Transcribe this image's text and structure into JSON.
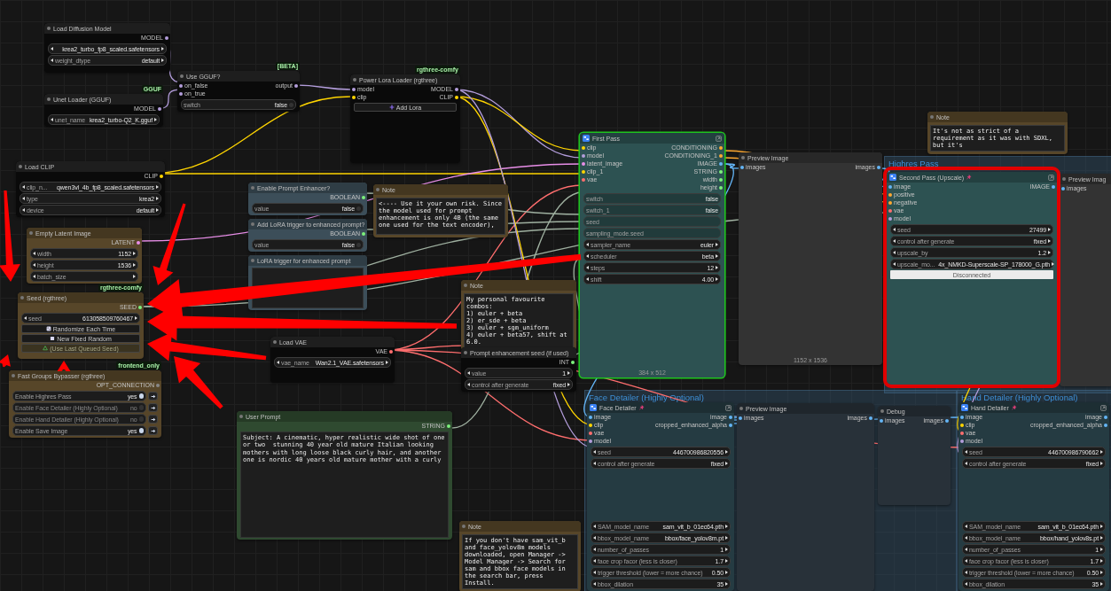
{
  "canvas": {
    "groups": [
      {
        "title": "Highres Pass"
      },
      {
        "title": "Face Detailer (Highly Optional)"
      },
      {
        "title": "Hand Detailer (Highly Optional)"
      }
    ],
    "nodes": [
      {
        "kind": "node",
        "title": "Load Diffusion Model",
        "color": "#0a0a0a",
        "selected": false,
        "outputs": [
          {
            "label": "MODEL",
            "color": "#b39ddb"
          }
        ],
        "widgets": [
          {
            "kind": "combo",
            "value": "krea2_turbo_fp8_scaled.safetensors"
          },
          {
            "kind": "combo",
            "label": "weight_dtype",
            "value": "default"
          }
        ]
      },
      {
        "kind": "node",
        "title": "Unet Loader (GGUF)",
        "badge": "GGUF",
        "color": "#0a0a0a",
        "selected": false,
        "outputs": [
          {
            "label": "MODEL",
            "color": "#b39ddb"
          }
        ],
        "widgets": [
          {
            "kind": "combo",
            "label": "unet_name",
            "value": "krea2_turbo-Q2_K.gguf"
          }
        ]
      },
      {
        "kind": "node",
        "title": "Use GGUF?",
        "badge": "[BETA]",
        "color": "#0a0a0a",
        "selected": false,
        "inputs": [
          {
            "label": "on_false",
            "color": "#b39ddb"
          },
          {
            "label": "on_true",
            "color": "#b39ddb"
          }
        ],
        "outputs": [
          {
            "label": "output",
            "color": "#b39ddb"
          }
        ],
        "widgets": [
          {
            "kind": "toggle",
            "label": "switch",
            "value": "false",
            "on": false
          }
        ]
      },
      {
        "kind": "node",
        "title": "Power Lora Loader (rgthree)",
        "badge": "rgthree-comfy",
        "color": "#0a0a0a",
        "selected": false,
        "inputs": [
          {
            "label": "model",
            "color": "#b39ddb"
          },
          {
            "label": "clip",
            "color": "#ffd500"
          }
        ],
        "outputs": [
          {
            "label": "MODEL",
            "color": "#b39ddb"
          },
          {
            "label": "CLIP",
            "color": "#ffd500"
          }
        ],
        "widgets": [
          {
            "kind": "button",
            "label": "Add Lora",
            "disabled": false
          }
        ]
      },
      {
        "kind": "node",
        "title": "Load CLIP",
        "color": "#0a0a0a",
        "selected": false,
        "outputs": [
          {
            "label": "CLIP",
            "color": "#ffd500"
          }
        ],
        "widgets": [
          {
            "kind": "combo",
            "label": "clip_n...",
            "value": "qwen3vl_4b_fp8_scaled.safetensors"
          },
          {
            "kind": "combo",
            "label": "type",
            "value": "krea2"
          },
          {
            "kind": "combo",
            "label": "device",
            "value": "default"
          }
        ]
      },
      {
        "kind": "node",
        "title": "Enable Prompt Enhancer?",
        "color": "#3c4e59",
        "selected": false,
        "outputs": [
          {
            "label": "BOOLEAN",
            "color": "#7cf07c"
          }
        ],
        "widgets": [
          {
            "kind": "toggle",
            "label": "value",
            "value": "false",
            "on": false
          }
        ]
      },
      {
        "kind": "note",
        "title": "Note",
        "color": "#574629",
        "selected": false,
        "text": "<---- Use it your own risk. Since the model used for prompt enhancement is only 4B (the same one used for the text encoder),"
      },
      {
        "kind": "node",
        "title": "Add LoRA trigger to enhanced prompt?",
        "color": "#3c4e59",
        "selected": false,
        "outputs": [
          {
            "label": "BOOLEAN",
            "color": "#7cf07c"
          }
        ],
        "widgets": [
          {
            "kind": "toggle",
            "label": "value",
            "value": "false",
            "on": false
          }
        ]
      },
      {
        "kind": "node",
        "title": "Empty Latent Image",
        "color": "#574629",
        "selected": false,
        "outputs": [
          {
            "label": "LATENT",
            "color": "#e88ee8"
          }
        ],
        "widgets": [
          {
            "kind": "combo",
            "label": "width",
            "value": "1152"
          },
          {
            "kind": "combo",
            "label": "height",
            "value": "1536"
          },
          {
            "kind": "combo",
            "label": "batch_size"
          }
        ]
      },
      {
        "kind": "node",
        "title": "LoRA trigger for enhanced prompt",
        "color": "#3c4e59",
        "selected": false,
        "widgets": [
          {
            "kind": "text"
          }
        ]
      },
      {
        "kind": "node",
        "title": "Seed (rgthree)",
        "badge": "rgthree-comfy",
        "color": "#574629",
        "selected": false,
        "outputs": [
          {
            "label": "SEED",
            "color": "#7cf07c"
          }
        ],
        "widgets": [
          {
            "kind": "combo",
            "label": "seed",
            "value": "613058509760467"
          },
          {
            "kind": "button",
            "label": "Randomize Each Time",
            "disabled": false
          },
          {
            "kind": "button",
            "label": "New Fixed Random",
            "disabled": false
          },
          {
            "kind": "button",
            "label": "(Use Last Queued Seed)",
            "disabled": true
          }
        ]
      },
      {
        "kind": "note",
        "title": "Note",
        "color": "#574629",
        "selected": false,
        "text": "My personal favourite combos:\n1) euler + beta\n2) er_sde + beta\n3) euler + sgm_uniform\n4) euler + beta57, shift at 6.0."
      },
      {
        "kind": "node",
        "title": "Load VAE",
        "color": "#0a0a0a",
        "selected": false,
        "outputs": [
          {
            "label": "VAE",
            "color": "#ff6e6e"
          }
        ],
        "widgets": [
          {
            "kind": "combo",
            "label": "vae_name",
            "value": "Wan2.1_VAE.safetensors"
          }
        ]
      },
      {
        "kind": "node",
        "title": "Prompt enhancement seed (if used)",
        "color": "#0a0a0a",
        "selected": false,
        "outputs": [
          {
            "label": "INT",
            "color": "#7cf07c"
          }
        ],
        "widgets": [
          {
            "kind": "combo",
            "label": "value",
            "value": "1"
          },
          {
            "kind": "combo",
            "label": "control after generate",
            "value": "fixed"
          }
        ]
      },
      {
        "kind": "node",
        "title": "Fast Groups Bypasser (rgthree)",
        "badge": "frontend_only",
        "color": "#574629",
        "selected": false,
        "outputs": [
          {
            "label": "OPT_CONNECTION",
            "color": "#888888"
          }
        ],
        "widgets": [
          {
            "kind": "group_toggle",
            "label": "Enable Highres Pass",
            "value": "yes",
            "on": true
          },
          {
            "kind": "group_toggle",
            "label": "Enable Face Detailer (Highly Optional)",
            "value": "no",
            "on": false
          },
          {
            "kind": "group_toggle",
            "label": "Enable Hand Detailer (Highly Optional)",
            "value": "no",
            "on": false
          },
          {
            "kind": "group_toggle",
            "label": "Enable Save Image",
            "value": "yes",
            "on": true
          }
        ]
      },
      {
        "kind": "node",
        "title": "User Prompt",
        "color": "#2f4a30",
        "selected": false,
        "outputs": [
          {
            "label": "STRING",
            "color": "#7cf07c"
          }
        ],
        "widgets": [
          {
            "kind": "text",
            "value": "Subject: A cinematic, hyper realistic wide shot of one or two  stunning 40 year old mature Italian looking mothers with long loose black curly hair, and another one is nordic 40 years old mature mother with a curly"
          }
        ]
      },
      {
        "kind": "node",
        "title": "First Pass",
        "color": "#2d5252",
        "selected": true,
        "subgraph": true,
        "inputs": [
          {
            "label": "clip",
            "color": "#ffd500"
          },
          {
            "label": "model",
            "color": "#b39ddb"
          },
          {
            "label": "latent_image",
            "color": "#e88ee8"
          },
          {
            "label": "clip_1",
            "color": "#ffd500"
          },
          {
            "label": "vae",
            "color": "#ff6e6e"
          }
        ],
        "outputs": [
          {
            "label": "CONDITIONING",
            "color": "#ffa931"
          },
          {
            "label": "CONDITIONING_1",
            "color": "#ffa931"
          },
          {
            "label": "IMAGE",
            "color": "#64b5f6"
          },
          {
            "label": "STRING",
            "color": "#7cf07c"
          },
          {
            "label": "width",
            "color": "#7cf07c"
          },
          {
            "label": "height",
            "color": "#7cf07c"
          }
        ],
        "widgets": [
          {
            "kind": "input",
            "label": "switch",
            "value": "false"
          },
          {
            "kind": "input",
            "label": "switch_1",
            "value": "false"
          },
          {
            "kind": "input",
            "label": "seed"
          },
          {
            "kind": "input",
            "label": "sampling_mode.seed"
          },
          {
            "kind": "combo",
            "label": "sampler_name",
            "value": "euler"
          },
          {
            "kind": "combo",
            "label": "scheduler",
            "value": "beta"
          },
          {
            "kind": "combo",
            "label": "steps",
            "value": "12"
          },
          {
            "kind": "combo",
            "label": "shift",
            "value": "4.00"
          }
        ],
        "footer": "384 x 512"
      },
      {
        "kind": "node",
        "title": "Preview Image",
        "color": "#333333",
        "selected": false,
        "inputs": [
          {
            "label": "images",
            "color": "#64b5f6"
          }
        ],
        "outputs": [
          {
            "label": "images",
            "color": "#64b5f6"
          }
        ],
        "footer": "1152 x 1536"
      },
      {
        "kind": "note",
        "title": "Note",
        "color": "#574629",
        "selected": false,
        "text": "It's not as strict of a requirement as it was with SDXL, but it's"
      },
      {
        "kind": "node",
        "title": "Second Pass (Upscale)",
        "color": "#2d5252",
        "selected": false,
        "subgraph": true,
        "pinned": true,
        "inputs": [
          {
            "label": "image",
            "color": "#64b5f6"
          },
          {
            "label": "positive",
            "color": "#ffa931"
          },
          {
            "label": "negative",
            "color": "#ffa931"
          },
          {
            "label": "vae",
            "color": "#ff6e6e"
          },
          {
            "label": "model",
            "color": "#b39ddb"
          }
        ],
        "outputs": [
          {
            "label": "IMAGE",
            "color": "#64b5f6"
          }
        ],
        "widgets": [
          {
            "kind": "combo",
            "label": "seed",
            "value": "27499"
          },
          {
            "kind": "combo",
            "label": "control after generate",
            "value": "fixed"
          },
          {
            "kind": "combo",
            "label": "upscale_by",
            "value": "1.2"
          },
          {
            "kind": "combo",
            "label": "upscale_mo...",
            "value": "4x_NMKD-Superscale-SP_178000_G.pth"
          },
          {
            "kind": "status",
            "label": "Disconnected"
          }
        ]
      },
      {
        "kind": "node",
        "title": "Preview Imag",
        "color": "#333333",
        "selected": false,
        "inputs": [
          {
            "label": "images",
            "color": "#64b5f6"
          }
        ]
      },
      {
        "kind": "node",
        "title": "Face Detailer",
        "color": "#253b42",
        "selected": false,
        "subgraph": true,
        "pinned": true,
        "inputs": [
          {
            "label": "image",
            "color": "#64b5f6"
          },
          {
            "label": "clip",
            "color": "#ffd500"
          },
          {
            "label": "vae",
            "color": "#ff6e6e"
          },
          {
            "label": "model",
            "color": "#b39ddb"
          }
        ],
        "outputs": [
          {
            "label": "image",
            "color": "#64b5f6"
          },
          {
            "label": "cropped_enhanced_alpha",
            "color": "#64b5f6"
          }
        ],
        "widgets": [
          {
            "kind": "combo",
            "label": "seed",
            "value": "446700986820556"
          },
          {
            "kind": "combo",
            "label": "control after generate",
            "value": "fixed"
          }
        ],
        "lower_widgets": [
          {
            "kind": "combo",
            "label": "SAM_model_name",
            "value": "sam_vit_b_01ec64.pth"
          },
          {
            "kind": "combo",
            "label": "bbox_model_name",
            "value": "bbox/face_yolov8m.pt"
          },
          {
            "kind": "combo",
            "label": "number_of_passes",
            "value": "1"
          },
          {
            "kind": "combo",
            "label": "face crop facor (less is closer)",
            "value": "1.7"
          },
          {
            "kind": "combo",
            "label": "trigger threshold (lower = more chance)",
            "value": "0.50"
          },
          {
            "kind": "combo",
            "label": "bbox_dilation",
            "value": "35"
          }
        ]
      },
      {
        "kind": "node",
        "title": "Preview Image",
        "color": "#283139",
        "selected": false,
        "inputs": [
          {
            "label": "images",
            "color": "#64b5f6"
          }
        ],
        "outputs": [
          {
            "label": "images",
            "color": "#64b5f6"
          }
        ]
      },
      {
        "kind": "node",
        "title": "Debug",
        "color": "#283139",
        "selected": false,
        "inputs": [
          {
            "label": "images",
            "color": "#64b5f6"
          }
        ],
        "outputs": [
          {
            "label": "images",
            "color": "#64b5f6"
          }
        ]
      },
      {
        "kind": "node",
        "title": "Hand Detailer",
        "color": "#253b42",
        "selected": false,
        "subgraph": true,
        "pinned": true,
        "inputs": [
          {
            "label": "image",
            "color": "#64b5f6"
          },
          {
            "label": "clip",
            "color": "#ffd500"
          },
          {
            "label": "vae",
            "color": "#ff6e6e"
          },
          {
            "label": "model",
            "color": "#b39ddb"
          }
        ],
        "outputs": [
          {
            "label": "image",
            "color": "#64b5f6"
          },
          {
            "label": "cropped_enhanced_alpha",
            "color": "#64b5f6"
          }
        ],
        "widgets": [
          {
            "kind": "combo",
            "label": "seed",
            "value": "446700986790662"
          },
          {
            "kind": "combo",
            "label": "control after generate",
            "value": "fixed"
          }
        ],
        "lower_widgets": [
          {
            "kind": "combo",
            "label": "SAM_model_name",
            "value": "sam_vit_b_01ec64.pth"
          },
          {
            "kind": "combo",
            "label": "bbox_model_name",
            "value": "bbox/hand_yolov8s.pt"
          },
          {
            "kind": "combo",
            "label": "number_of_passes",
            "value": "1"
          },
          {
            "kind": "combo",
            "label": "face crop facor (less is closer)",
            "value": "1.7"
          },
          {
            "kind": "combo",
            "label": "trigger threshold (lower = more chance)",
            "value": "0.50"
          },
          {
            "kind": "combo",
            "label": "bbox_dilation",
            "value": "35"
          }
        ]
      },
      {
        "kind": "note",
        "title": "Note",
        "color": "#574629",
        "selected": false,
        "text": "If you don't have sam_vit_b and face_yolov8m models downloaded, open Manager -> Model Manager -> Search for sam and bbox face models in the search bar, press Install."
      }
    ]
  }
}
